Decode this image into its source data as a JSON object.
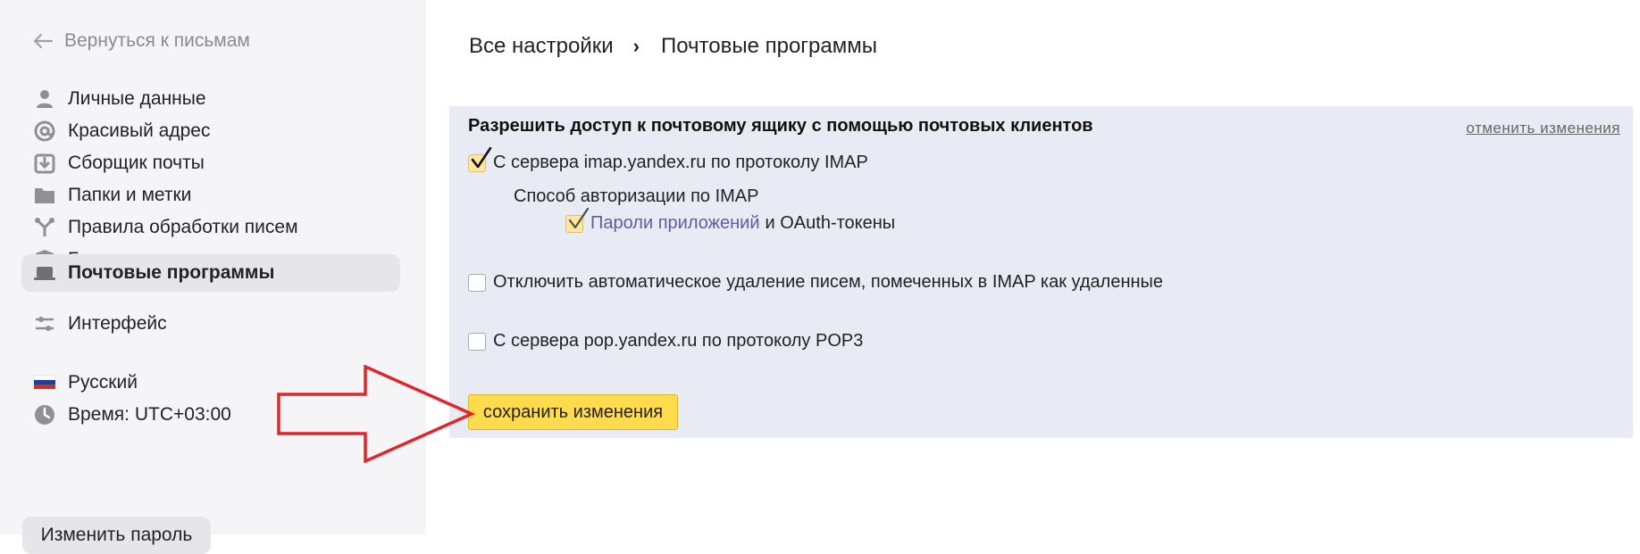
{
  "sidebar": {
    "back_label": "Вернуться к письмам",
    "items": [
      {
        "label": "Личные данные",
        "icon": "person-icon"
      },
      {
        "label": "Красивый адрес",
        "icon": "at-icon"
      },
      {
        "label": "Сборщик почты",
        "icon": "download-icon"
      },
      {
        "label": "Папки и метки",
        "icon": "folder-icon"
      },
      {
        "label": "Правила обработки писем",
        "icon": "fork-icon"
      },
      {
        "label": "Безопасность",
        "icon": "shield-icon"
      },
      {
        "label": "Почтовые программы",
        "icon": "laptop-icon",
        "active": true
      },
      {
        "label": "Интерфейс",
        "icon": "sliders-icon"
      }
    ],
    "language": {
      "label": "Русский",
      "icon": "russia-flag-icon"
    },
    "time": {
      "label": "Время: UTC+03:00",
      "icon": "clock-icon"
    },
    "change_password_label": "Изменить пароль"
  },
  "breadcrumb": {
    "root": "Все настройки",
    "separator": "›",
    "current": "Почтовые программы"
  },
  "panel": {
    "title": "Разрешить доступ к почтовому ящику с помощью почтовых клиентов",
    "cancel_link": "отменить изменения",
    "imap": {
      "label": "С сервера imap.yandex.ru по протоколу IMAP",
      "checked": true
    },
    "auth_method_label": "Способ авторизации по IMAP",
    "app_passwords": {
      "link_label": "Пароли приложений",
      "rest_label": "и OAuth-токены",
      "checked": true
    },
    "disable_autodelete": {
      "label": "Отключить автоматическое удаление писем, помеченных в IMAP как удаленные",
      "checked": false
    },
    "pop3": {
      "label": "С сервера pop.yandex.ru по протоколу POP3",
      "checked": false
    },
    "save_label": "сохранить изменения"
  },
  "colors": {
    "sidebar_bg": "#f5f5f7",
    "active_item_bg": "#e6e6ea",
    "panel_bg": "#e9ebf4",
    "save_button": "#ffdb4d",
    "link": "#5a5f9e",
    "annotation_arrow": "#e0262b"
  }
}
